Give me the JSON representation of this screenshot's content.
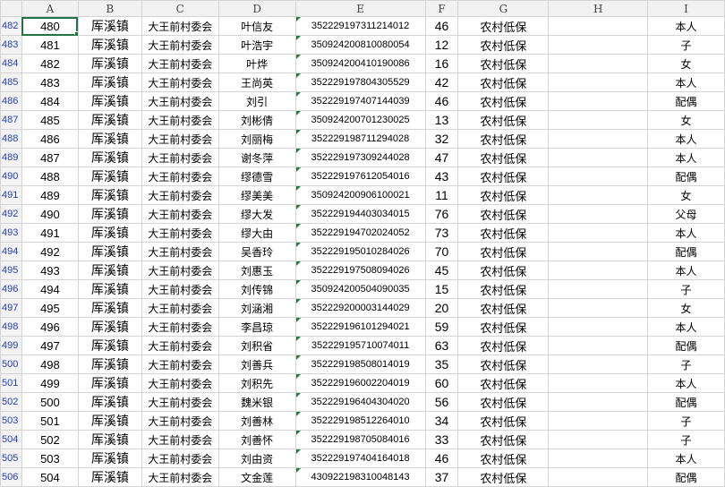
{
  "columns": [
    "A",
    "B",
    "C",
    "D",
    "E",
    "F",
    "G",
    "H",
    "I"
  ],
  "rows": [
    {
      "n": "482",
      "a": "480",
      "b": "厍溪镇",
      "c": "大王前村委会",
      "d": "叶信友",
      "e": "352229197311214012",
      "f": "46",
      "g": "农村低保",
      "h": "",
      "i": "本人"
    },
    {
      "n": "483",
      "a": "481",
      "b": "厍溪镇",
      "c": "大王前村委会",
      "d": "叶浩宇",
      "e": "350924200810080054",
      "f": "12",
      "g": "农村低保",
      "h": "",
      "i": "子"
    },
    {
      "n": "484",
      "a": "482",
      "b": "厍溪镇",
      "c": "大王前村委会",
      "d": "叶烨",
      "e": "350924200410190086",
      "f": "16",
      "g": "农村低保",
      "h": "",
      "i": "女"
    },
    {
      "n": "485",
      "a": "483",
      "b": "厍溪镇",
      "c": "大王前村委会",
      "d": "王尚英",
      "e": "352229197804305529",
      "f": "42",
      "g": "农村低保",
      "h": "",
      "i": "本人"
    },
    {
      "n": "486",
      "a": "484",
      "b": "厍溪镇",
      "c": "大王前村委会",
      "d": "刘引",
      "e": "352229197407144039",
      "f": "46",
      "g": "农村低保",
      "h": "",
      "i": "配偶"
    },
    {
      "n": "487",
      "a": "485",
      "b": "厍溪镇",
      "c": "大王前村委会",
      "d": "刘彬倩",
      "e": "350924200701230025",
      "f": "13",
      "g": "农村低保",
      "h": "",
      "i": "女"
    },
    {
      "n": "488",
      "a": "486",
      "b": "厍溪镇",
      "c": "大王前村委会",
      "d": "刘丽梅",
      "e": "352229198711294028",
      "f": "32",
      "g": "农村低保",
      "h": "",
      "i": "本人"
    },
    {
      "n": "489",
      "a": "487",
      "b": "厍溪镇",
      "c": "大王前村委会",
      "d": "谢冬萍",
      "e": "352229197309244028",
      "f": "47",
      "g": "农村低保",
      "h": "",
      "i": "本人"
    },
    {
      "n": "490",
      "a": "488",
      "b": "厍溪镇",
      "c": "大王前村委会",
      "d": "缪德雪",
      "e": "352229197612054016",
      "f": "43",
      "g": "农村低保",
      "h": "",
      "i": "配偶"
    },
    {
      "n": "491",
      "a": "489",
      "b": "厍溪镇",
      "c": "大王前村委会",
      "d": "缪美美",
      "e": "350924200906100021",
      "f": "11",
      "g": "农村低保",
      "h": "",
      "i": "女"
    },
    {
      "n": "492",
      "a": "490",
      "b": "厍溪镇",
      "c": "大王前村委会",
      "d": "缪大发",
      "e": "352229194403034015",
      "f": "76",
      "g": "农村低保",
      "h": "",
      "i": "父母"
    },
    {
      "n": "493",
      "a": "491",
      "b": "厍溪镇",
      "c": "大王前村委会",
      "d": "缪大由",
      "e": "352229194702024052",
      "f": "73",
      "g": "农村低保",
      "h": "",
      "i": "本人"
    },
    {
      "n": "494",
      "a": "492",
      "b": "厍溪镇",
      "c": "大王前村委会",
      "d": "吴香玲",
      "e": "352229195010284026",
      "f": "70",
      "g": "农村低保",
      "h": "",
      "i": "配偶"
    },
    {
      "n": "495",
      "a": "493",
      "b": "厍溪镇",
      "c": "大王前村委会",
      "d": "刘惠玉",
      "e": "352229197508094026",
      "f": "45",
      "g": "农村低保",
      "h": "",
      "i": "本人"
    },
    {
      "n": "496",
      "a": "494",
      "b": "厍溪镇",
      "c": "大王前村委会",
      "d": "刘传锦",
      "e": "350924200504090035",
      "f": "15",
      "g": "农村低保",
      "h": "",
      "i": "子"
    },
    {
      "n": "497",
      "a": "495",
      "b": "厍溪镇",
      "c": "大王前村委会",
      "d": "刘涵湘",
      "e": "352229200003144029",
      "f": "20",
      "g": "农村低保",
      "h": "",
      "i": "女"
    },
    {
      "n": "498",
      "a": "496",
      "b": "厍溪镇",
      "c": "大王前村委会",
      "d": "李昌琼",
      "e": "352229196101294021",
      "f": "59",
      "g": "农村低保",
      "h": "",
      "i": "本人"
    },
    {
      "n": "499",
      "a": "497",
      "b": "厍溪镇",
      "c": "大王前村委会",
      "d": "刘积省",
      "e": "352229195710074011",
      "f": "63",
      "g": "农村低保",
      "h": "",
      "i": "配偶"
    },
    {
      "n": "500",
      "a": "498",
      "b": "厍溪镇",
      "c": "大王前村委会",
      "d": "刘善兵",
      "e": "352229198508014019",
      "f": "35",
      "g": "农村低保",
      "h": "",
      "i": "子"
    },
    {
      "n": "501",
      "a": "499",
      "b": "厍溪镇",
      "c": "大王前村委会",
      "d": "刘积先",
      "e": "352229196002204019",
      "f": "60",
      "g": "农村低保",
      "h": "",
      "i": "本人"
    },
    {
      "n": "502",
      "a": "500",
      "b": "厍溪镇",
      "c": "大王前村委会",
      "d": "魏米银",
      "e": "352229196404304020",
      "f": "56",
      "g": "农村低保",
      "h": "",
      "i": "配偶"
    },
    {
      "n": "503",
      "a": "501",
      "b": "厍溪镇",
      "c": "大王前村委会",
      "d": "刘善林",
      "e": "352229198512264010",
      "f": "34",
      "g": "农村低保",
      "h": "",
      "i": "子"
    },
    {
      "n": "504",
      "a": "502",
      "b": "厍溪镇",
      "c": "大王前村委会",
      "d": "刘善怀",
      "e": "352229198705084016",
      "f": "33",
      "g": "农村低保",
      "h": "",
      "i": "子"
    },
    {
      "n": "505",
      "a": "503",
      "b": "厍溪镇",
      "c": "大王前村委会",
      "d": "刘由资",
      "e": "352229197404164018",
      "f": "46",
      "g": "农村低保",
      "h": "",
      "i": "本人"
    },
    {
      "n": "506",
      "a": "504",
      "b": "厍溪镇",
      "c": "大王前村委会",
      "d": "文金莲",
      "e": "430922198310048143",
      "f": "37",
      "g": "农村低保",
      "h": "",
      "i": "配偶"
    }
  ],
  "colors": {
    "row_header_text": "#2440c4",
    "grid": "#d4d4d4",
    "selection": "#217346",
    "comment_marker": "#1e7e34"
  }
}
